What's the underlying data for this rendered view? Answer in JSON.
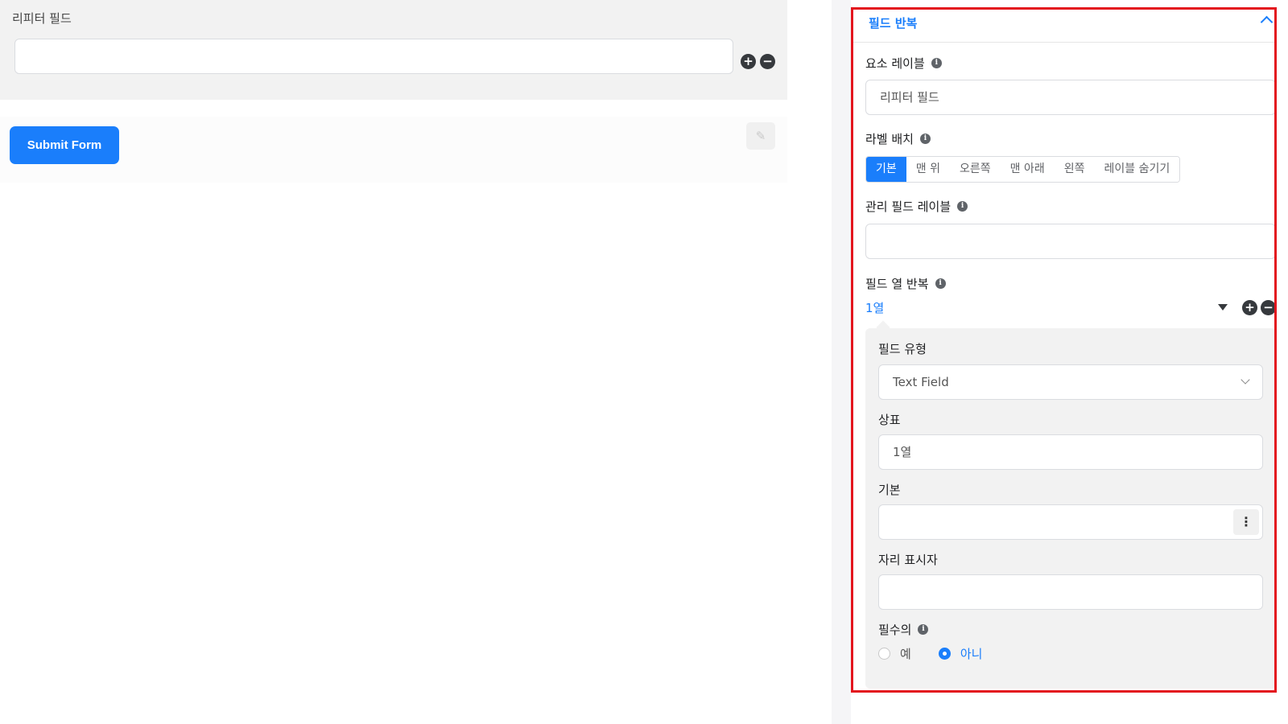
{
  "colors": {
    "accent": "#1a7efb",
    "highlight": "#e3151e"
  },
  "preview": {
    "field_label": "리피터 필드",
    "submit_label": "Submit Form",
    "add_row_symbol": "+",
    "remove_row_symbol": "−",
    "edit_icon": "pencil-icon"
  },
  "panel": {
    "title": "필드 반복",
    "element_label": {
      "label": "요소 레이블",
      "value": "리피터 필드"
    },
    "label_placement": {
      "label": "라벨 배치",
      "options": [
        "기본",
        "맨 위",
        "오른쪽",
        "맨 아래",
        "왼쪽",
        "레이블 숨기기"
      ],
      "selected": "기본"
    },
    "admin_label": {
      "label": "관리 필드 레이블",
      "value": ""
    },
    "repeat_columns": {
      "label": "필드 열 반복",
      "current_column": "1열",
      "add_symbol": "+",
      "remove_symbol": "−",
      "column": {
        "field_type": {
          "label": "필드 유형",
          "value": "Text Field"
        },
        "label_field": {
          "label": "상표",
          "value": "1열"
        },
        "default_field": {
          "label": "기본",
          "value": "",
          "menu_symbol": "⋮"
        },
        "placeholder_field": {
          "label": "자리 표시자",
          "value": ""
        },
        "required": {
          "label": "필수의",
          "options": [
            "예",
            "아니"
          ],
          "selected": "아니"
        }
      }
    }
  }
}
